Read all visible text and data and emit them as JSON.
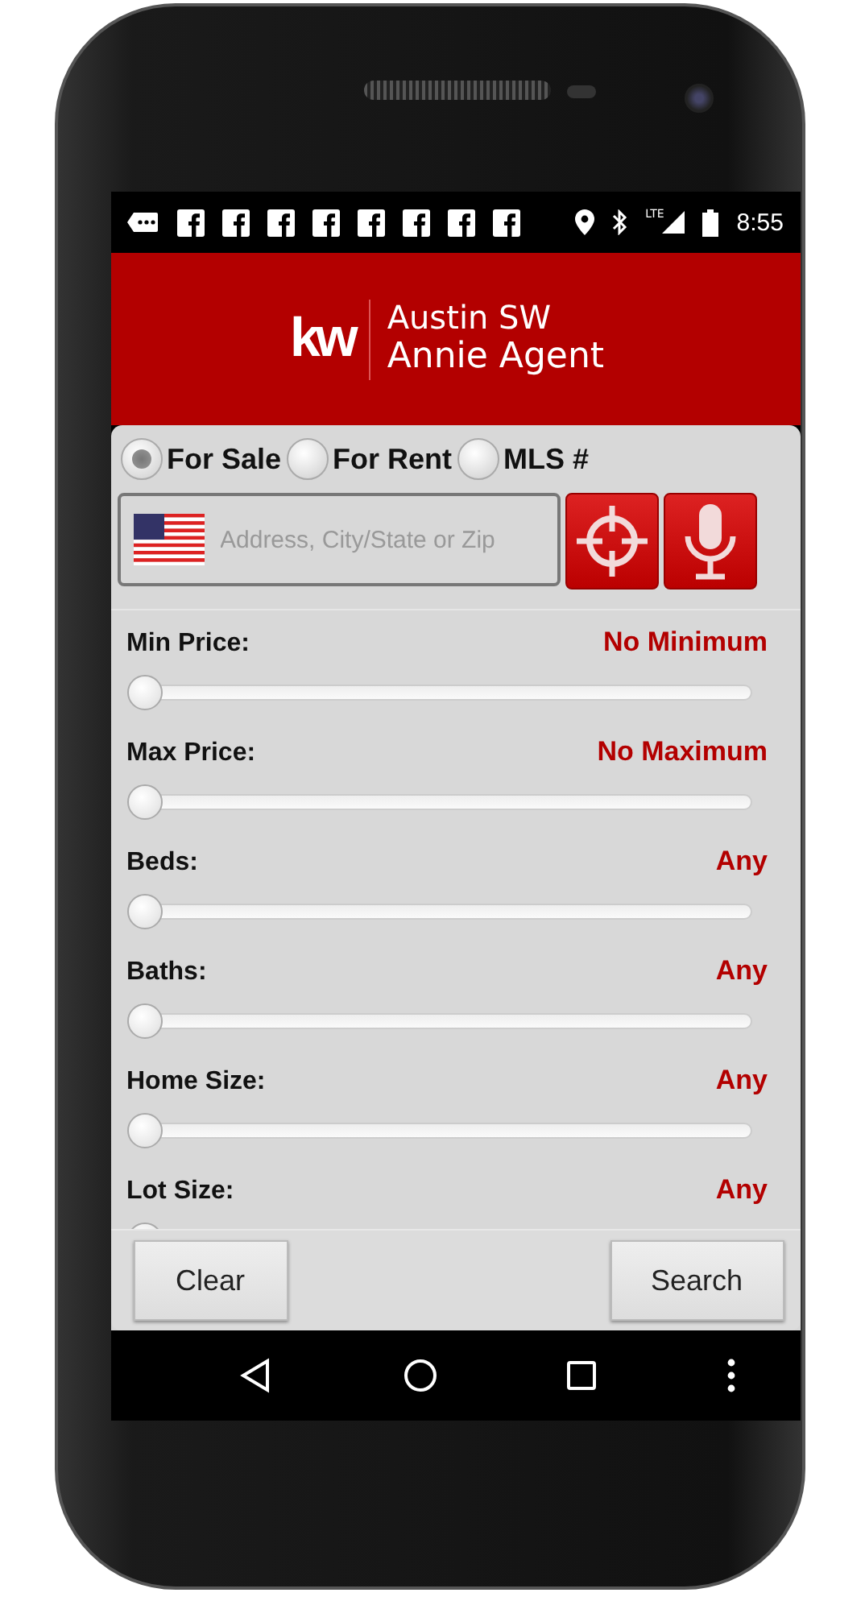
{
  "status_bar": {
    "network": "LTE",
    "time": "8:55"
  },
  "header": {
    "logo": "kw",
    "office": "Austin SW",
    "agent": "Annie Agent"
  },
  "listing_type": [
    {
      "label": "For Sale",
      "selected": true
    },
    {
      "label": "For Rent",
      "selected": false
    },
    {
      "label": "MLS #",
      "selected": false
    }
  ],
  "search": {
    "placeholder": "Address, City/State or Zip"
  },
  "filters": [
    {
      "label": "Min Price:",
      "value": "No Minimum",
      "level": 0
    },
    {
      "label": "Max Price:",
      "value": "No Maximum",
      "level": 0
    },
    {
      "label": "Beds:",
      "value": "Any",
      "level": 0
    },
    {
      "label": "Baths:",
      "value": "Any",
      "level": 0
    },
    {
      "label": "Home Size:",
      "value": "Any",
      "level": 0
    },
    {
      "label": "Lot Size:",
      "value": "Any",
      "level": 0
    }
  ],
  "buttons": {
    "clear": "Clear",
    "search": "Search"
  }
}
